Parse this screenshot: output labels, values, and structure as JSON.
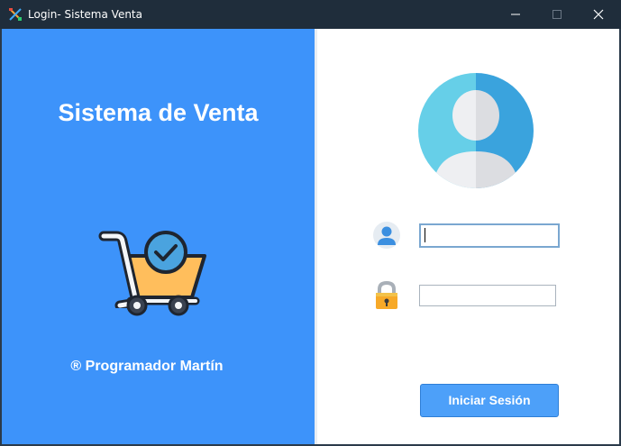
{
  "window": {
    "title": "Login- Sistema Venta",
    "controls": {
      "minimize": "minimize-icon",
      "maximize": "maximize-icon",
      "close": "close-icon"
    }
  },
  "left": {
    "title": "Sistema de Venta",
    "illustration": "shopping-cart-check-icon",
    "credit": "® Programador Martín"
  },
  "login": {
    "avatar_icon": "user-avatar-icon",
    "username": {
      "icon": "user-icon",
      "value": ""
    },
    "password": {
      "icon": "lock-icon",
      "value": ""
    },
    "submit_label": "Iniciar Sesión"
  },
  "colors": {
    "left_panel": "#3d93fa",
    "titlebar": "#1f2d3b",
    "button": "#4da0f9"
  }
}
